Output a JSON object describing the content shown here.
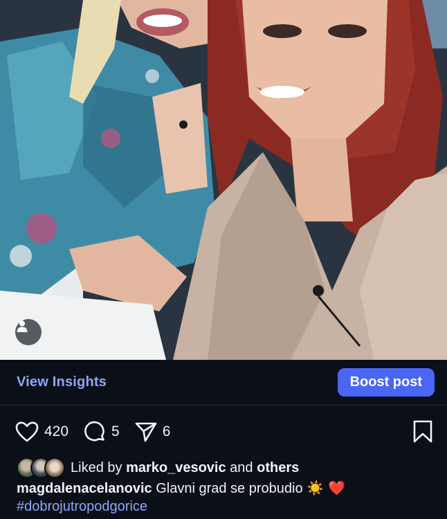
{
  "photo": {
    "tag_icon": "person-icon"
  },
  "insights": {
    "view_label": "View Insights",
    "boost_label": "Boost post"
  },
  "actions": {
    "likes": "420",
    "comments": "5",
    "shares": "6",
    "like_icon": "heart-icon",
    "comment_icon": "comment-icon",
    "share_icon": "send-icon",
    "save_icon": "bookmark-icon"
  },
  "liked_by": {
    "prefix": "Liked by",
    "user": "marko_vesovic",
    "middle": "and",
    "others": "others"
  },
  "caption": {
    "username": "magdalenacelanovic",
    "text": "Glavni grad se probudio",
    "emojis": "☀️ ❤️",
    "hashtag": "#dobrojutropodgorice"
  },
  "colors": {
    "background": "#0b0f17",
    "accent_link": "#8ea6ff",
    "boost_button": "#4a66f5"
  }
}
